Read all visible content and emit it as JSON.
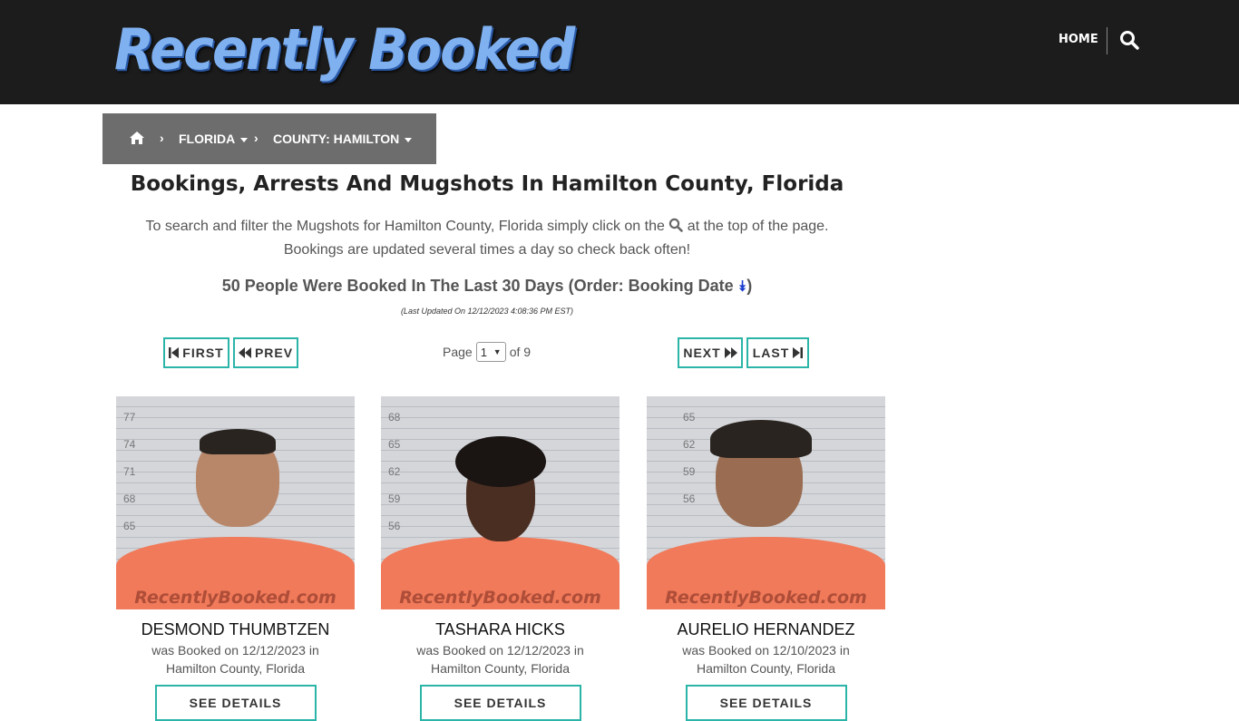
{
  "header": {
    "logo_text": "Recently Booked",
    "nav_home": "HOME",
    "search_icon": "search-icon"
  },
  "breadcrumb": {
    "home_icon": "home-icon",
    "state": "FLORIDA",
    "county": "COUNTY: HAMILTON"
  },
  "main": {
    "title": "Bookings, Arrests And Mugshots In Hamilton County, Florida",
    "intro_part1": "To search and filter the Mugshots for Hamilton County, Florida simply click on the",
    "intro_part2": "at the top of the page.",
    "intro_line2": "Bookings are updated several times a day so check back often!",
    "count_text": "50 People Were Booked In The Last 30 Days (Order: Booking Date",
    "count_close": ")",
    "updated": "(Last Updated On 12/12/2023 4:08:36 PM EST)"
  },
  "pagination": {
    "first": "FIRST",
    "prev": "PREV",
    "next": "NEXT",
    "last": "LAST",
    "page_label": "Page",
    "page_value": "1",
    "of_label": "of 9"
  },
  "mugshot_scales": [
    "77",
    "74",
    "71",
    "68",
    "65",
    "62",
    "59",
    "56"
  ],
  "watermark": "RecentlyBooked.com",
  "cards": [
    {
      "name": "DESMOND THUMBTZEN",
      "booked_line1": "was Booked on 12/12/2023 in",
      "booked_line2": "Hamilton County, Florida",
      "details": "SEE DETAILS"
    },
    {
      "name": "TASHARA HICKS",
      "booked_line1": "was Booked on 12/12/2023 in",
      "booked_line2": "Hamilton County, Florida",
      "details": "SEE DETAILS"
    },
    {
      "name": "AURELIO HERNANDEZ",
      "booked_line1": "was Booked on 12/10/2023 in",
      "booked_line2": "Hamilton County, Florida",
      "details": "SEE DETAILS"
    }
  ],
  "colors": {
    "accent": "#2bb5a8",
    "header_bg": "#1c1c1c",
    "breadcrumb_bg": "#6d6d6d"
  }
}
